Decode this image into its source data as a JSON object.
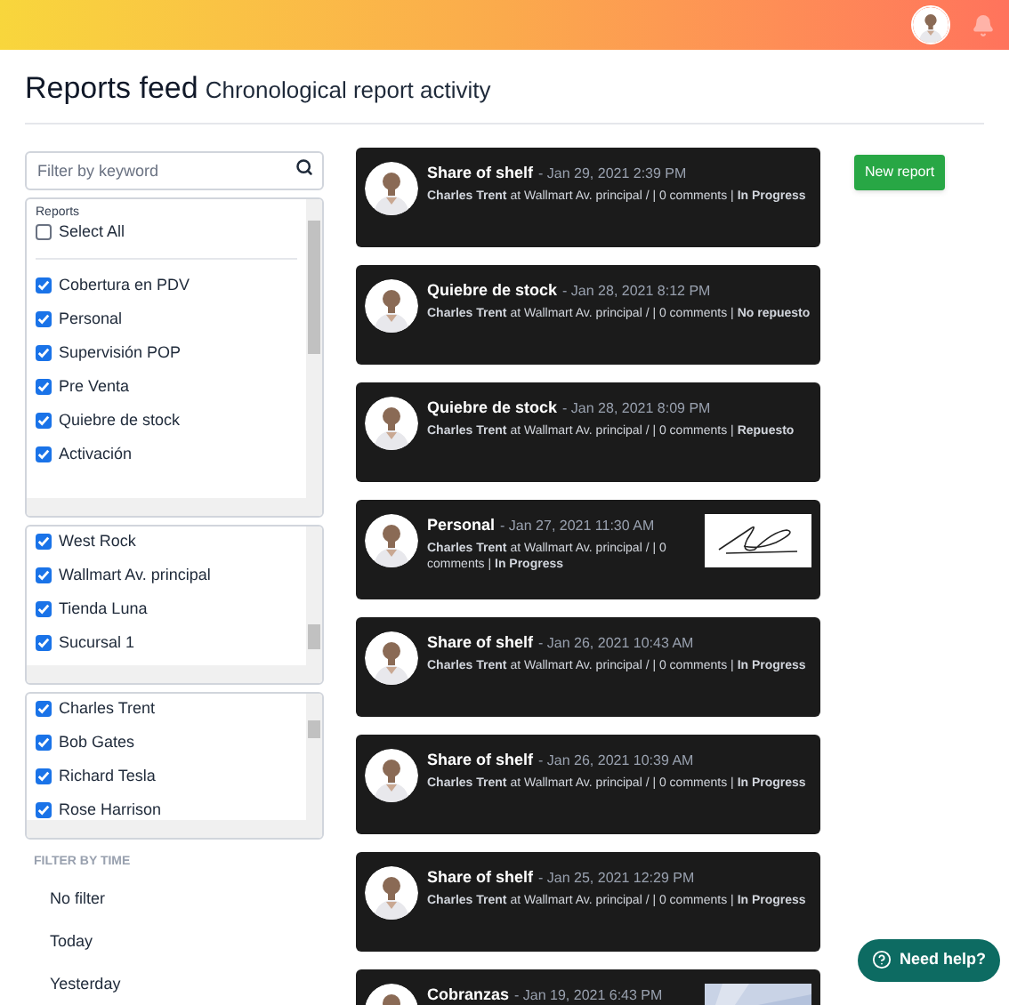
{
  "page": {
    "title": "Reports feed",
    "subtitle": "Chronological report activity"
  },
  "search": {
    "placeholder": "Filter by keyword"
  },
  "reports_filter": {
    "label": "Reports",
    "select_all": {
      "label": "Select All",
      "checked": false
    },
    "items": [
      {
        "label": "Cobertura en PDV",
        "checked": true
      },
      {
        "label": "Personal",
        "checked": true
      },
      {
        "label": "Supervisión POP",
        "checked": true
      },
      {
        "label": "Pre Venta",
        "checked": true
      },
      {
        "label": "Quiebre de stock",
        "checked": true
      },
      {
        "label": "Activación",
        "checked": true
      }
    ]
  },
  "stores_filter": {
    "items": [
      {
        "label": "West Rock",
        "checked": true
      },
      {
        "label": "Wallmart Av. principal",
        "checked": true
      },
      {
        "label": "Tienda Luna",
        "checked": true
      },
      {
        "label": "Sucursal 1",
        "checked": true
      }
    ]
  },
  "users_filter": {
    "items": [
      {
        "label": "Charles Trent",
        "checked": true
      },
      {
        "label": "Bob Gates",
        "checked": true
      },
      {
        "label": "Richard Tesla",
        "checked": true
      },
      {
        "label": "Rose Harrison",
        "checked": true
      }
    ]
  },
  "time_filter": {
    "label": "FILTER BY TIME",
    "options": [
      {
        "label": "No filter",
        "selected": false
      },
      {
        "label": "Today",
        "selected": false
      },
      {
        "label": "Yesterday",
        "selected": false
      }
    ]
  },
  "new_report_button": "New report",
  "feed": [
    {
      "kind": "plain",
      "title": "Share of shelf",
      "date": "- Jan 29, 2021 2:39 PM",
      "details": "**Charles Trent** at Wallmart Av. principal / | 0 comments | **In Progress**"
    },
    {
      "kind": "plain",
      "title": "Quiebre de stock",
      "date": "- Jan 28, 2021 8:12 PM",
      "details": "**Charles Trent** at Wallmart Av. principal / | 0 comments | **No repuesto**"
    },
    {
      "kind": "plain",
      "title": "Quiebre de stock",
      "date": "- Jan 28, 2021 8:09 PM",
      "details": "**Charles Trent** at Wallmart Av. principal / | 0 comments | **Repuesto**"
    },
    {
      "kind": "signature",
      "title": "Personal",
      "date": "- Jan 27, 2021 11:30 AM",
      "details": "**Charles Trent** at Wallmart Av. principal / | 0 comments | **In Progress**"
    },
    {
      "kind": "plain",
      "title": "Share of shelf",
      "date": "- Jan 26, 2021 10:43 AM",
      "details": "**Charles Trent** at Wallmart Av. principal / | 0 comments | **In Progress**"
    },
    {
      "kind": "plain",
      "title": "Share of shelf",
      "date": "- Jan 26, 2021 10:39 AM",
      "details": "**Charles Trent** at Wallmart Av. principal / | 0 comments | **In Progress**"
    },
    {
      "kind": "plain",
      "title": "Share of shelf",
      "date": "- Jan 25, 2021 12:29 PM",
      "details": "**Charles Trent** at Wallmart Av. principal / | 0 comments | **In Progress**"
    },
    {
      "title": "Cobranzas",
      "date": "- Jan 19, 2021 6:43 PM"
    }
  ],
  "help_button": "Need help?"
}
